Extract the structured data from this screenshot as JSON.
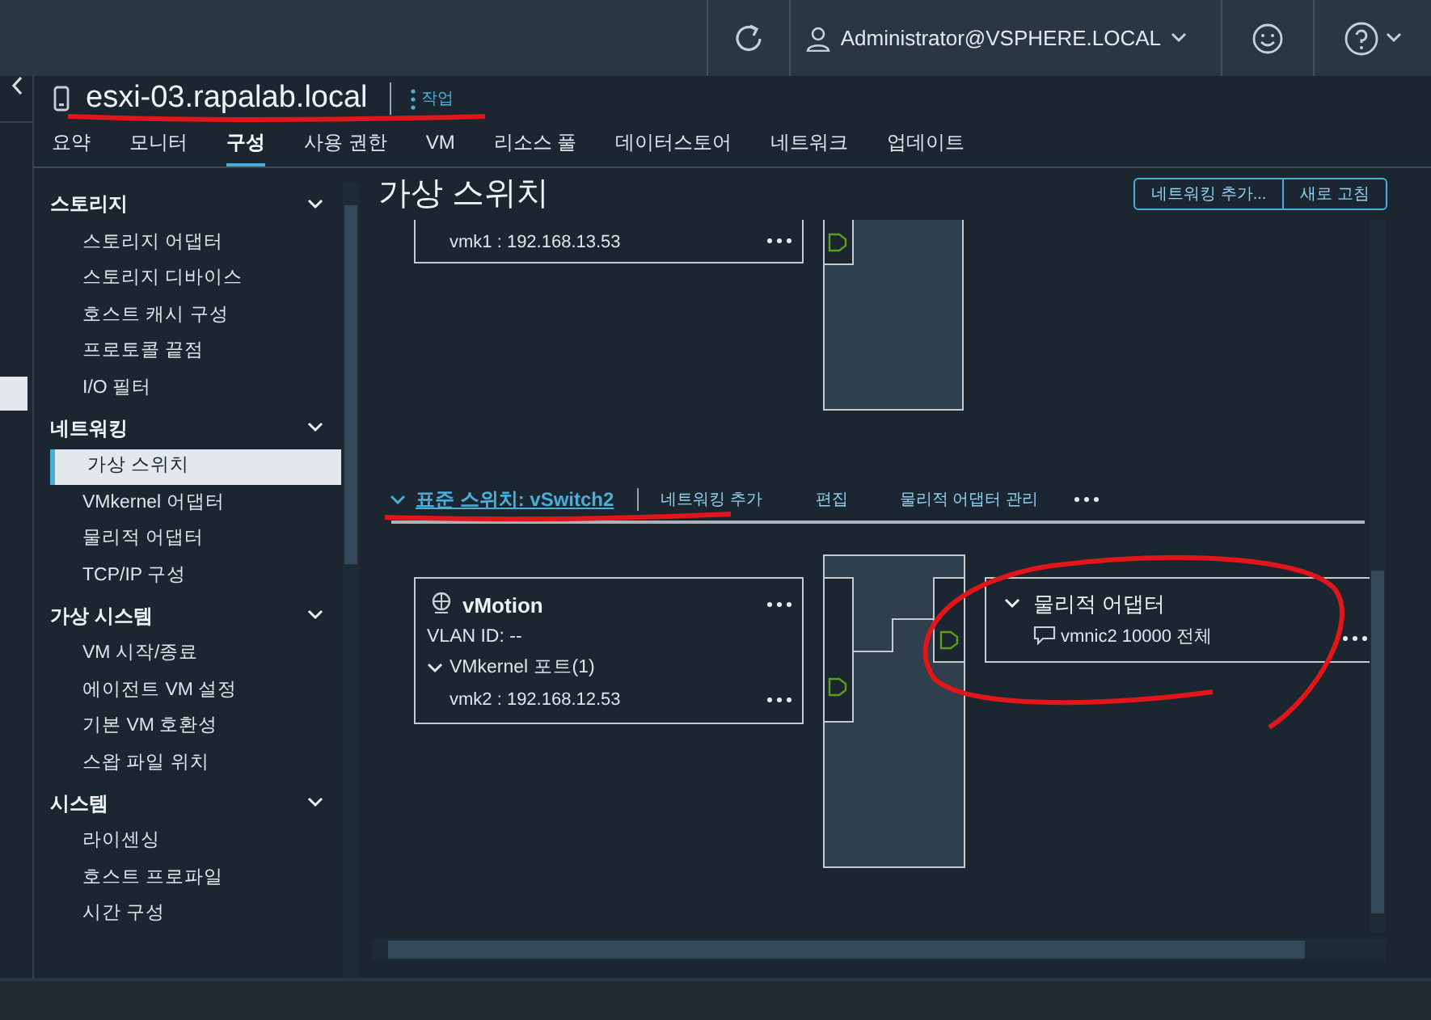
{
  "header": {
    "user": "Administrator@VSPHERE.LOCAL"
  },
  "host": {
    "name": "esxi-03.rapalab.local",
    "actions_label": "작업"
  },
  "tabs": [
    {
      "label": "요약",
      "selected": false
    },
    {
      "label": "모니터",
      "selected": false
    },
    {
      "label": "구성",
      "selected": true
    },
    {
      "label": "사용 권한",
      "selected": false
    },
    {
      "label": "VM",
      "selected": false
    },
    {
      "label": "리소스 풀",
      "selected": false
    },
    {
      "label": "데이터스토어",
      "selected": false
    },
    {
      "label": "네트워크",
      "selected": false
    },
    {
      "label": "업데이트",
      "selected": false
    }
  ],
  "sidebar": {
    "sections": [
      {
        "title": "스토리지",
        "expanded": true,
        "items": [
          {
            "label": "스토리지 어댑터",
            "selected": false
          },
          {
            "label": "스토리지 디바이스",
            "selected": false
          },
          {
            "label": "호스트 캐시 구성",
            "selected": false
          },
          {
            "label": "프로토콜 끝점",
            "selected": false
          },
          {
            "label": "I/O 필터",
            "selected": false
          }
        ]
      },
      {
        "title": "네트워킹",
        "expanded": true,
        "items": [
          {
            "label": "가상 스위치",
            "selected": true
          },
          {
            "label": "VMkernel 어댑터",
            "selected": false
          },
          {
            "label": "물리적 어댑터",
            "selected": false
          },
          {
            "label": "TCP/IP 구성",
            "selected": false
          }
        ]
      },
      {
        "title": "가상 시스템",
        "expanded": true,
        "items": [
          {
            "label": "VM 시작/종료",
            "selected": false
          },
          {
            "label": "에이전트 VM 설정",
            "selected": false
          },
          {
            "label": "기본 VM 호환성",
            "selected": false
          },
          {
            "label": "스왑 파일 위치",
            "selected": false
          }
        ]
      },
      {
        "title": "시스템",
        "expanded": true,
        "items": [
          {
            "label": "라이센싱",
            "selected": false
          },
          {
            "label": "호스트 프로파일",
            "selected": false
          },
          {
            "label": "시간 구성",
            "selected": false
          }
        ]
      }
    ]
  },
  "content": {
    "title": "가상 스위치",
    "buttons": [
      "네트워킹 추가...",
      "새로 고침"
    ],
    "upper_port": {
      "vmk": "vmk1 : 192.168.13.53"
    },
    "switch": {
      "label": "표준 스위치: vSwitch2",
      "expanded": true,
      "actions": [
        "네트워킹 추가",
        "편집",
        "물리적 어댑터 관리"
      ],
      "port_group": {
        "name": "vMotion",
        "vlan": "VLAN ID: --",
        "ports_label": "VMkernel 포트(1)",
        "ports_expanded": true,
        "vmk": "vmk2 : 192.168.12.53"
      },
      "adapters": {
        "title": "물리적 어댑터",
        "expanded": true,
        "items": [
          "vmnic2 10000 전체"
        ]
      }
    }
  }
}
